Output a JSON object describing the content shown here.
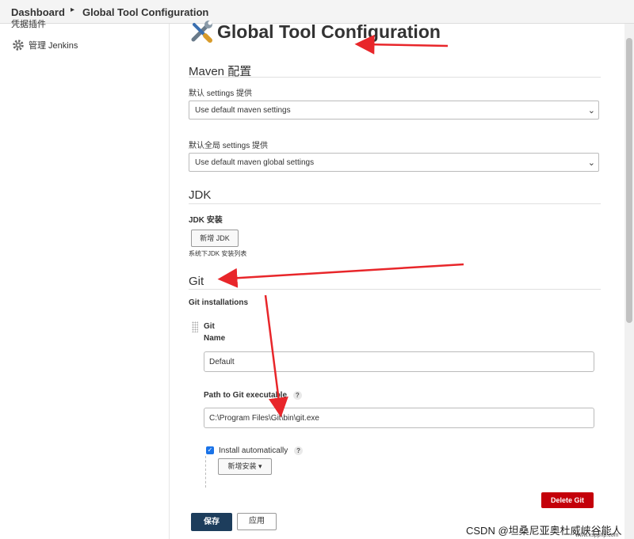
{
  "breadcrumb": {
    "home": "Dashboard",
    "current": "Global Tool Configuration"
  },
  "sidebar": {
    "partial_item": "凭据插件",
    "manage_label": "管理 Jenkins"
  },
  "page": {
    "title": "Global Tool Configuration"
  },
  "maven": {
    "heading": "Maven 配置",
    "settings_label": "默认 settings 提供",
    "settings_value": "Use default maven settings",
    "global_settings_label": "默认全局 settings 提供",
    "global_settings_value": "Use default maven global settings"
  },
  "jdk": {
    "heading": "JDK",
    "install_label": "JDK 安装",
    "add_button": "新增 JDK",
    "list_note": "系统下JDK 安装列表"
  },
  "git": {
    "heading": "Git",
    "installations_label": "Git installations",
    "item_title": "Git",
    "name_label": "Name",
    "name_value": "Default",
    "path_label": "Path to Git executable",
    "path_value": "C:\\Program Files\\Git\\bin\\git.exe",
    "install_auto_label": "Install automatically",
    "install_auto_checked": true,
    "add_installer_button": "新增安装",
    "delete_button": "Delete Git",
    "help_glyph": "?"
  },
  "footer": {
    "save_button": "保存",
    "apply_button": "应用"
  },
  "watermark": {
    "text": "CSDN @坦桑尼亚奥杜威峡谷能人",
    "site": "www.kspphp.com"
  },
  "colors": {
    "annotation_red": "#e8262a",
    "primary": "#1d3d5c",
    "danger": "#c4000a",
    "checkbox": "#1a73e8"
  },
  "icons": {
    "settings": "gear-icon",
    "title": "wrench-screwdriver-icon",
    "select": "chevron-down-icon"
  }
}
